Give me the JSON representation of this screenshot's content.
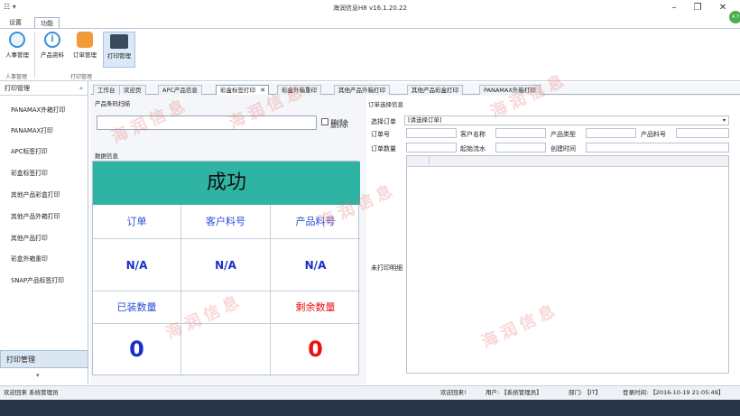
{
  "window": {
    "title": "海润信息H8 v16.1.20.22"
  },
  "menu_tabs": [
    {
      "label": "设置"
    },
    {
      "label": "功能"
    }
  ],
  "ribbon": {
    "buttons": [
      {
        "label": "人事管理"
      },
      {
        "label": "产品资料"
      },
      {
        "label": "订单管理"
      },
      {
        "label": "打印管理"
      }
    ],
    "groups": [
      {
        "label": "人事管理"
      },
      {
        "label": "打印管理"
      }
    ]
  },
  "sidebar": {
    "header": "打印管理",
    "items": [
      {
        "label": "PANAMAX外箱打印"
      },
      {
        "label": "PANAMAX打印"
      },
      {
        "label": "APC标签打印"
      },
      {
        "label": "彩盒标签打印"
      },
      {
        "label": "其他产品彩盒打印"
      },
      {
        "label": "其他产品外箱打印"
      },
      {
        "label": "其他产品打印"
      },
      {
        "label": "彩盒外箱重印"
      },
      {
        "label": "SNAP产品标签打印"
      }
    ],
    "bottom_label": "打印管理"
  },
  "tabs": [
    {
      "label": "工作台"
    },
    {
      "label": "欢迎页"
    },
    {
      "label": "APC产品信息"
    },
    {
      "label": "彩盒标签打印"
    },
    {
      "label": "彩盒外箱重印"
    },
    {
      "label": "其他产品外箱打印"
    },
    {
      "label": "其他产品彩盒打印"
    },
    {
      "label": "PANAMAX外箱打印"
    }
  ],
  "scan": {
    "title": "产品条码扫描",
    "delete_label": "删除",
    "value": ""
  },
  "data_info": {
    "title": "数据信息",
    "status": "成功",
    "labels": {
      "order": "订单",
      "customer_part": "客户料号",
      "product_part": "产品料号",
      "packed_qty": "已装数量",
      "remaining_qty": "剩余数量"
    },
    "values": {
      "order": "N/A",
      "customer_part": "N/A",
      "product_part": "N/A",
      "packed_qty": "0",
      "remaining_qty": "0"
    }
  },
  "order_select": {
    "title": "订单选择信息",
    "select_label": "选择订单",
    "select_value": "[请选择订单]",
    "fields": {
      "order_no": "订单号",
      "customer_name": "客户名称",
      "product_type": "产品类型",
      "product_part_no": "产品料号",
      "order_qty": "订单数量",
      "start_serial": "起始流水",
      "create_time": "创建时间"
    },
    "unprinted_label": "未打印明细"
  },
  "statusbar": {
    "left": "欢迎回来 系统管理员",
    "welcome": "欢迎回来!",
    "user": "用户: 【系统管理员】",
    "dept": "部门: 【IT】",
    "login": "登录时间: 【2016-10-19 21:05:49】"
  },
  "watermark": "海润信息",
  "colors": {
    "success_bg": "#2fb4a3",
    "label_blue": "#2a4fd8",
    "label_red": "#e11111"
  }
}
